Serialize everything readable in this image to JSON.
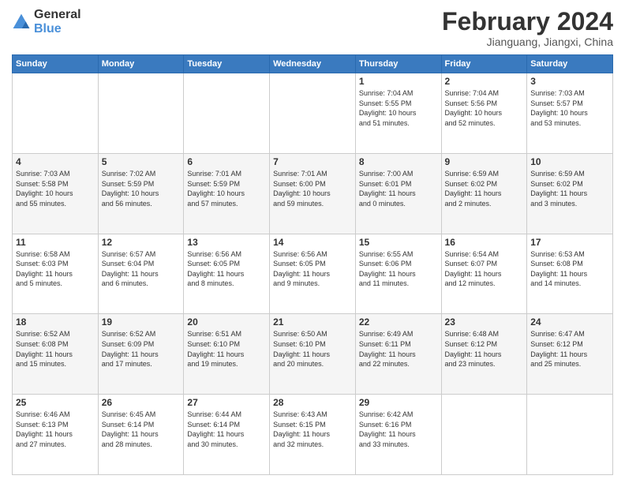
{
  "header": {
    "logo_line1": "General",
    "logo_line2": "Blue",
    "title": "February 2024",
    "subtitle": "Jianguang, Jiangxi, China"
  },
  "weekdays": [
    "Sunday",
    "Monday",
    "Tuesday",
    "Wednesday",
    "Thursday",
    "Friday",
    "Saturday"
  ],
  "weeks": [
    [
      {
        "day": "",
        "info": ""
      },
      {
        "day": "",
        "info": ""
      },
      {
        "day": "",
        "info": ""
      },
      {
        "day": "",
        "info": ""
      },
      {
        "day": "1",
        "info": "Sunrise: 7:04 AM\nSunset: 5:55 PM\nDaylight: 10 hours\nand 51 minutes."
      },
      {
        "day": "2",
        "info": "Sunrise: 7:04 AM\nSunset: 5:56 PM\nDaylight: 10 hours\nand 52 minutes."
      },
      {
        "day": "3",
        "info": "Sunrise: 7:03 AM\nSunset: 5:57 PM\nDaylight: 10 hours\nand 53 minutes."
      }
    ],
    [
      {
        "day": "4",
        "info": "Sunrise: 7:03 AM\nSunset: 5:58 PM\nDaylight: 10 hours\nand 55 minutes."
      },
      {
        "day": "5",
        "info": "Sunrise: 7:02 AM\nSunset: 5:59 PM\nDaylight: 10 hours\nand 56 minutes."
      },
      {
        "day": "6",
        "info": "Sunrise: 7:01 AM\nSunset: 5:59 PM\nDaylight: 10 hours\nand 57 minutes."
      },
      {
        "day": "7",
        "info": "Sunrise: 7:01 AM\nSunset: 6:00 PM\nDaylight: 10 hours\nand 59 minutes."
      },
      {
        "day": "8",
        "info": "Sunrise: 7:00 AM\nSunset: 6:01 PM\nDaylight: 11 hours\nand 0 minutes."
      },
      {
        "day": "9",
        "info": "Sunrise: 6:59 AM\nSunset: 6:02 PM\nDaylight: 11 hours\nand 2 minutes."
      },
      {
        "day": "10",
        "info": "Sunrise: 6:59 AM\nSunset: 6:02 PM\nDaylight: 11 hours\nand 3 minutes."
      }
    ],
    [
      {
        "day": "11",
        "info": "Sunrise: 6:58 AM\nSunset: 6:03 PM\nDaylight: 11 hours\nand 5 minutes."
      },
      {
        "day": "12",
        "info": "Sunrise: 6:57 AM\nSunset: 6:04 PM\nDaylight: 11 hours\nand 6 minutes."
      },
      {
        "day": "13",
        "info": "Sunrise: 6:56 AM\nSunset: 6:05 PM\nDaylight: 11 hours\nand 8 minutes."
      },
      {
        "day": "14",
        "info": "Sunrise: 6:56 AM\nSunset: 6:05 PM\nDaylight: 11 hours\nand 9 minutes."
      },
      {
        "day": "15",
        "info": "Sunrise: 6:55 AM\nSunset: 6:06 PM\nDaylight: 11 hours\nand 11 minutes."
      },
      {
        "day": "16",
        "info": "Sunrise: 6:54 AM\nSunset: 6:07 PM\nDaylight: 11 hours\nand 12 minutes."
      },
      {
        "day": "17",
        "info": "Sunrise: 6:53 AM\nSunset: 6:08 PM\nDaylight: 11 hours\nand 14 minutes."
      }
    ],
    [
      {
        "day": "18",
        "info": "Sunrise: 6:52 AM\nSunset: 6:08 PM\nDaylight: 11 hours\nand 15 minutes."
      },
      {
        "day": "19",
        "info": "Sunrise: 6:52 AM\nSunset: 6:09 PM\nDaylight: 11 hours\nand 17 minutes."
      },
      {
        "day": "20",
        "info": "Sunrise: 6:51 AM\nSunset: 6:10 PM\nDaylight: 11 hours\nand 19 minutes."
      },
      {
        "day": "21",
        "info": "Sunrise: 6:50 AM\nSunset: 6:10 PM\nDaylight: 11 hours\nand 20 minutes."
      },
      {
        "day": "22",
        "info": "Sunrise: 6:49 AM\nSunset: 6:11 PM\nDaylight: 11 hours\nand 22 minutes."
      },
      {
        "day": "23",
        "info": "Sunrise: 6:48 AM\nSunset: 6:12 PM\nDaylight: 11 hours\nand 23 minutes."
      },
      {
        "day": "24",
        "info": "Sunrise: 6:47 AM\nSunset: 6:12 PM\nDaylight: 11 hours\nand 25 minutes."
      }
    ],
    [
      {
        "day": "25",
        "info": "Sunrise: 6:46 AM\nSunset: 6:13 PM\nDaylight: 11 hours\nand 27 minutes."
      },
      {
        "day": "26",
        "info": "Sunrise: 6:45 AM\nSunset: 6:14 PM\nDaylight: 11 hours\nand 28 minutes."
      },
      {
        "day": "27",
        "info": "Sunrise: 6:44 AM\nSunset: 6:14 PM\nDaylight: 11 hours\nand 30 minutes."
      },
      {
        "day": "28",
        "info": "Sunrise: 6:43 AM\nSunset: 6:15 PM\nDaylight: 11 hours\nand 32 minutes."
      },
      {
        "day": "29",
        "info": "Sunrise: 6:42 AM\nSunset: 6:16 PM\nDaylight: 11 hours\nand 33 minutes."
      },
      {
        "day": "",
        "info": ""
      },
      {
        "day": "",
        "info": ""
      }
    ]
  ]
}
